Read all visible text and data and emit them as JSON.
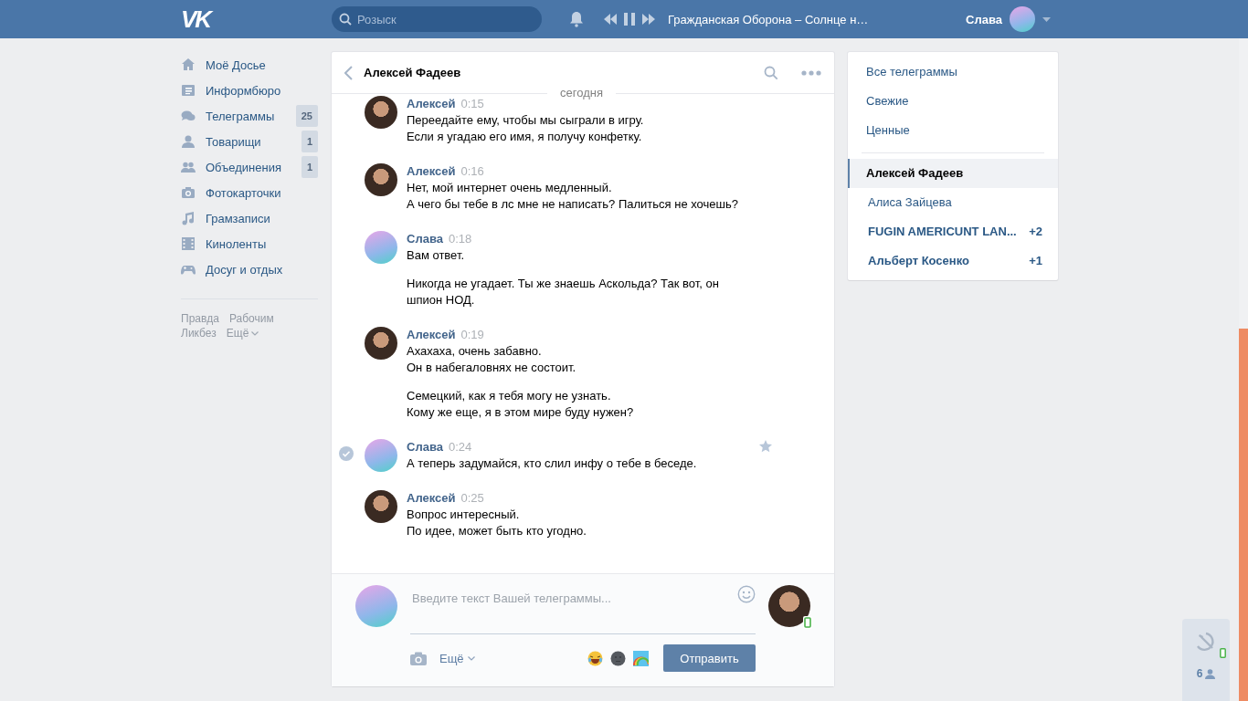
{
  "header": {
    "logo": "VK",
    "search": {
      "placeholder": "Розыск"
    },
    "player": {
      "playing": true,
      "track": "Гражданская Оборона – Солнце н…"
    },
    "user": {
      "name": "Слава"
    }
  },
  "sidebar": {
    "items": [
      {
        "label": "Моё Досье"
      },
      {
        "label": "Информбюро"
      },
      {
        "label": "Телеграммы",
        "count": "25"
      },
      {
        "label": "Товарищи",
        "count": "1"
      },
      {
        "label": "Объединения",
        "count": "1"
      },
      {
        "label": "Фотокарточки"
      },
      {
        "label": "Грамзаписи"
      },
      {
        "label": "Киноленты"
      },
      {
        "label": "Досуг и отдых"
      }
    ],
    "footer_links": [
      "Правда",
      "Рабочим",
      "Ликбез",
      "Ещё"
    ]
  },
  "chat": {
    "title": "Алексей Фадеев",
    "date_divider": "сегодня",
    "messages": [
      {
        "kind": "contact",
        "author": "Алексей",
        "time": "0:15",
        "selected": false,
        "paragraphs": [
          [
            "Переедайте ему, чтобы мы сыграли в игру.",
            "Если я угадаю его имя, я получу конфетку."
          ]
        ]
      },
      {
        "kind": "contact",
        "author": "Алексей",
        "time": "0:16",
        "selected": false,
        "paragraphs": [
          [
            "Нет, мой интернет очень медленный.",
            "А чего бы тебе в лс мне не написать? Палиться не хочешь?"
          ]
        ]
      },
      {
        "kind": "self",
        "author": "Слава",
        "time": "0:18",
        "selected": false,
        "paragraphs": [
          [
            "Вам ответ."
          ],
          [
            "Никогда не угадает. Ты же знаешь Аскольда? Так вот, он",
            "шпион НОД."
          ]
        ]
      },
      {
        "kind": "contact",
        "author": "Алексей",
        "time": "0:19",
        "selected": false,
        "paragraphs": [
          [
            "Ахахаха, очень забавно.",
            "Он в набегаловнях не состоит."
          ],
          [
            "Семецкий, как я тебя могу не узнать.",
            "Кому же еще, я в этом мире буду нужен?"
          ]
        ]
      },
      {
        "kind": "self",
        "author": "Слава",
        "time": "0:24",
        "selected": true,
        "paragraphs": [
          [
            "А теперь задумайся, кто слил инфу о тебе в беседе."
          ]
        ]
      },
      {
        "kind": "contact",
        "author": "Алексей",
        "time": "0:25",
        "selected": false,
        "paragraphs": [
          [
            "Вопрос интересный.",
            "По идее, может быть кто угодно."
          ]
        ]
      }
    ],
    "composer": {
      "placeholder": "Введите текст Вашей телеграммы...",
      "more": "Ещё",
      "send": "Отправить"
    }
  },
  "folders": [
    {
      "label": "Все телеграммы"
    },
    {
      "label": "Свежие"
    },
    {
      "label": "Ценные"
    }
  ],
  "dialogs": [
    {
      "name": "Алексей Фадеев",
      "selected": true,
      "unread": false
    },
    {
      "name": "Алиса Зайцева",
      "selected": false,
      "unread": false
    },
    {
      "name": "FUGIN AMERICUNT LAN...",
      "selected": false,
      "unread": true,
      "count": "+2"
    },
    {
      "name": "Альберт Косенко",
      "selected": false,
      "unread": true,
      "count": "+1"
    }
  ],
  "widget": {
    "count": "6"
  }
}
